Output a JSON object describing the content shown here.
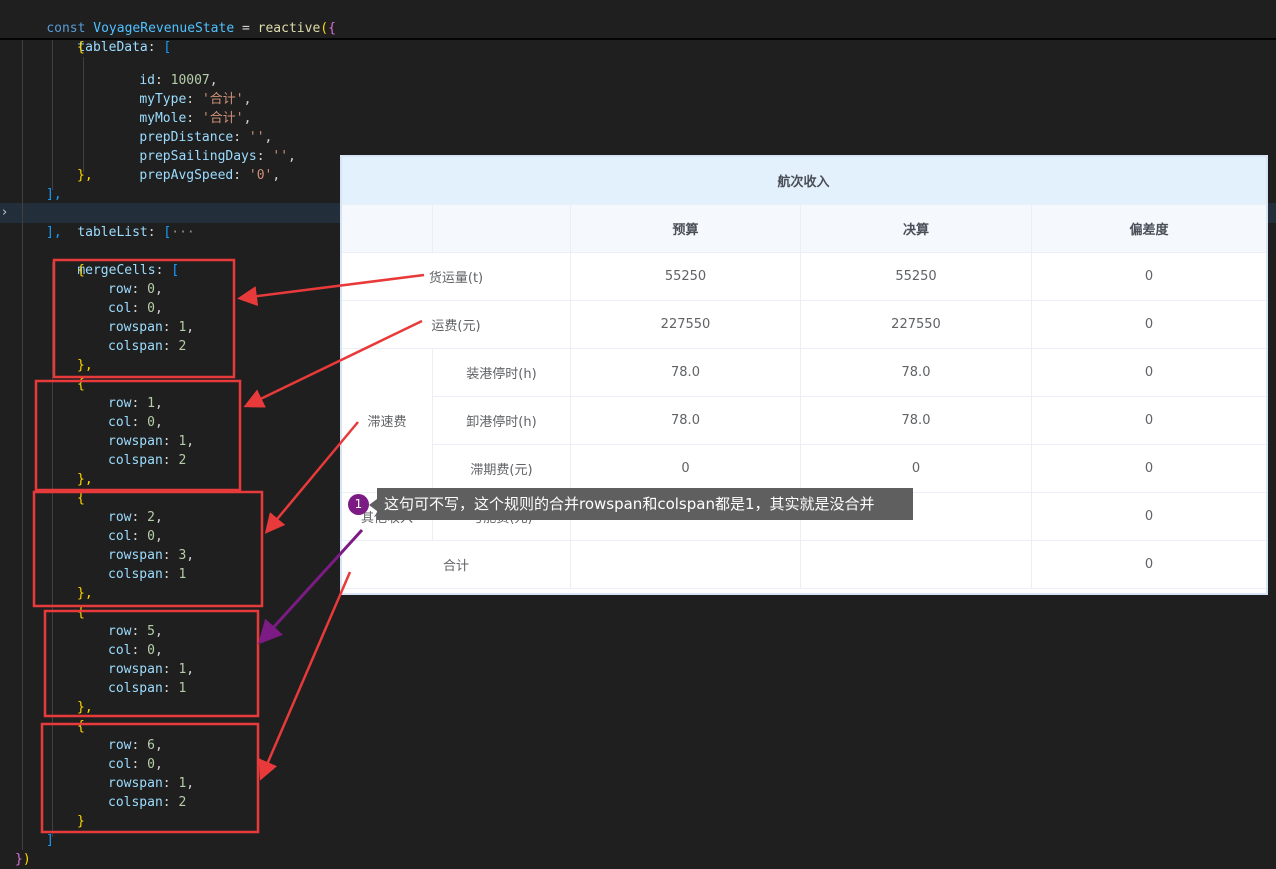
{
  "code": {
    "line_const": {
      "kw": "const",
      "name": "VoyageRevenueState",
      "eq": " = ",
      "fn": "reactive",
      "open1": "(",
      "open2": "{"
    },
    "line_tableData": {
      "key": "tableData",
      "colon": ": ",
      "bracket": "["
    },
    "obj_open": "{",
    "obj_close": "},",
    "row_id": {
      "key": "id",
      "value": "10007"
    },
    "row_myType": {
      "key": "myType",
      "value": "'合计'"
    },
    "row_myMole": {
      "key": "myMole",
      "value": "'合计'"
    },
    "row_prepDistance": {
      "key": "prepDistance",
      "value": "''"
    },
    "row_prepSailingDays": {
      "key": "prepSailingDays",
      "value": "''"
    },
    "row_prepAvgSpeed": {
      "key": "prepAvgSpeed",
      "value": "'0'"
    },
    "array_close": "],",
    "line_tableList": {
      "key": "tableList",
      "colon": ": ",
      "bracket": "[",
      "ellipsis": "···"
    },
    "line_mergeCells": {
      "key": "mergeCells",
      "colon": ": ",
      "bracket": "["
    },
    "merge_cells": [
      {
        "row": "0",
        "col": "0",
        "rowspan": "1",
        "colspan": "2"
      },
      {
        "row": "1",
        "col": "0",
        "rowspan": "1",
        "colspan": "2"
      },
      {
        "row": "2",
        "col": "0",
        "rowspan": "3",
        "colspan": "1"
      },
      {
        "row": "5",
        "col": "0",
        "rowspan": "1",
        "colspan": "1"
      },
      {
        "row": "6",
        "col": "0",
        "rowspan": "1",
        "colspan": "2"
      }
    ],
    "key_labels": {
      "row": "row",
      "col": "col",
      "rowspan": "rowspan",
      "colspan": "colspan"
    },
    "last_obj_close": "}",
    "merge_close": "]",
    "final_close": {
      "brace": "}",
      "paren": ")"
    }
  },
  "table": {
    "title": "航次收入",
    "headers": [
      "预算",
      "决算",
      "偏差度"
    ],
    "rows": [
      {
        "label": "货运量(t)",
        "budget": "55250",
        "final": "55250",
        "deviation": "0"
      },
      {
        "label": "运费(元)",
        "budget": "227550",
        "final": "227550",
        "deviation": "0"
      },
      {
        "group": "滞速费",
        "label": "装港停时(h)",
        "budget": "78.0",
        "final": "78.0",
        "deviation": "0"
      },
      {
        "label": "卸港停时(h)",
        "budget": "78.0",
        "final": "78.0",
        "deviation": "0"
      },
      {
        "label": "滞期费(元)",
        "budget": "0",
        "final": "0",
        "deviation": "0"
      },
      {
        "group": "其他收入",
        "label": "亏舱费(元)",
        "budget": "",
        "final": "",
        "deviation": "0"
      },
      {
        "label": "合计",
        "budget": "",
        "final": "",
        "deviation": "0"
      }
    ]
  },
  "tooltip": {
    "badge": "1",
    "text": "这句可不写，这个规则的合并rowspan和colspan都是1，其实就是没合并"
  },
  "colors": {
    "editor_bg": "#1f1f1f",
    "annotation_red": "#e83a3a",
    "annotation_purple": "#7b1b83",
    "table_title_bg": "#e3f1fd"
  }
}
